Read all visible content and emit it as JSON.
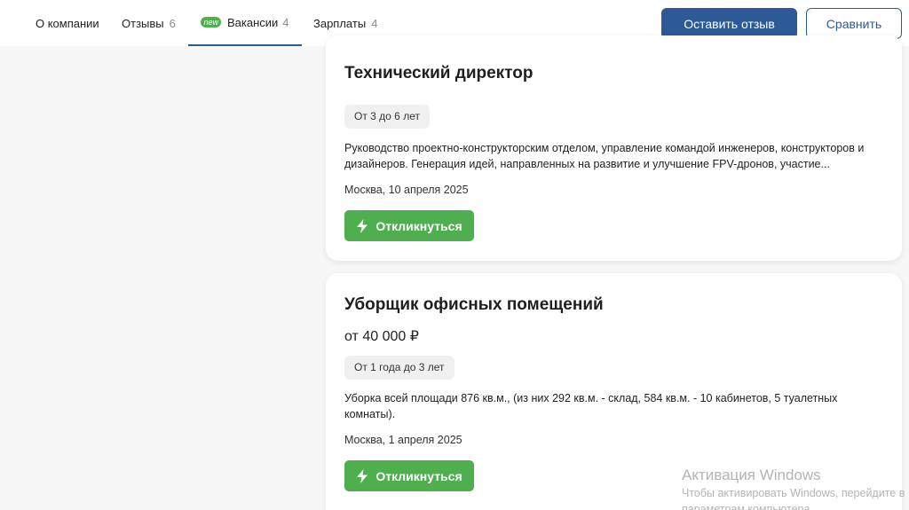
{
  "tabs": {
    "about": {
      "label": "О компании"
    },
    "reviews": {
      "label": "Отзывы",
      "count": "6"
    },
    "vacancies": {
      "badge": "new",
      "label": "Вакансии",
      "count": "4"
    },
    "salaries": {
      "label": "Зарплаты",
      "count": "4"
    }
  },
  "actions": {
    "leave_review": "Оставить отзыв",
    "compare": "Сравнить"
  },
  "vacancies": [
    {
      "title": "Технический директор",
      "experience": "От 3 до 6 лет",
      "description": "Руководство проектно-конструкторским отделом, управление командой инженеров, конструкторов и дизайнеров. Генерация идей, направленных на развитие и улучшение FPV-дронов, участие...",
      "location_date": "Москва, 10 апреля 2025",
      "apply_label": "Откликнуться"
    },
    {
      "title": "Уборщик офисных помещений",
      "salary": "от 40 000 ₽",
      "experience": "От 1 года до 3 лет",
      "description": "Уборка всей площади 876 кв.м., (из них 292 кв.м. - склад, 584 кв.м. - 10 кабинетов, 5 туалетных комнаты).",
      "location_date": "Москва, 1 апреля 2025",
      "apply_label": "Откликнуться"
    }
  ],
  "watermark": {
    "title": "Активация Windows",
    "line1": "Чтобы активировать Windows, перейдите в",
    "line2": "параметрам компьютера"
  },
  "colors": {
    "primary": "#2c5a97",
    "apply_green": "#4fae4e",
    "new_badge": "#4fae4e"
  }
}
